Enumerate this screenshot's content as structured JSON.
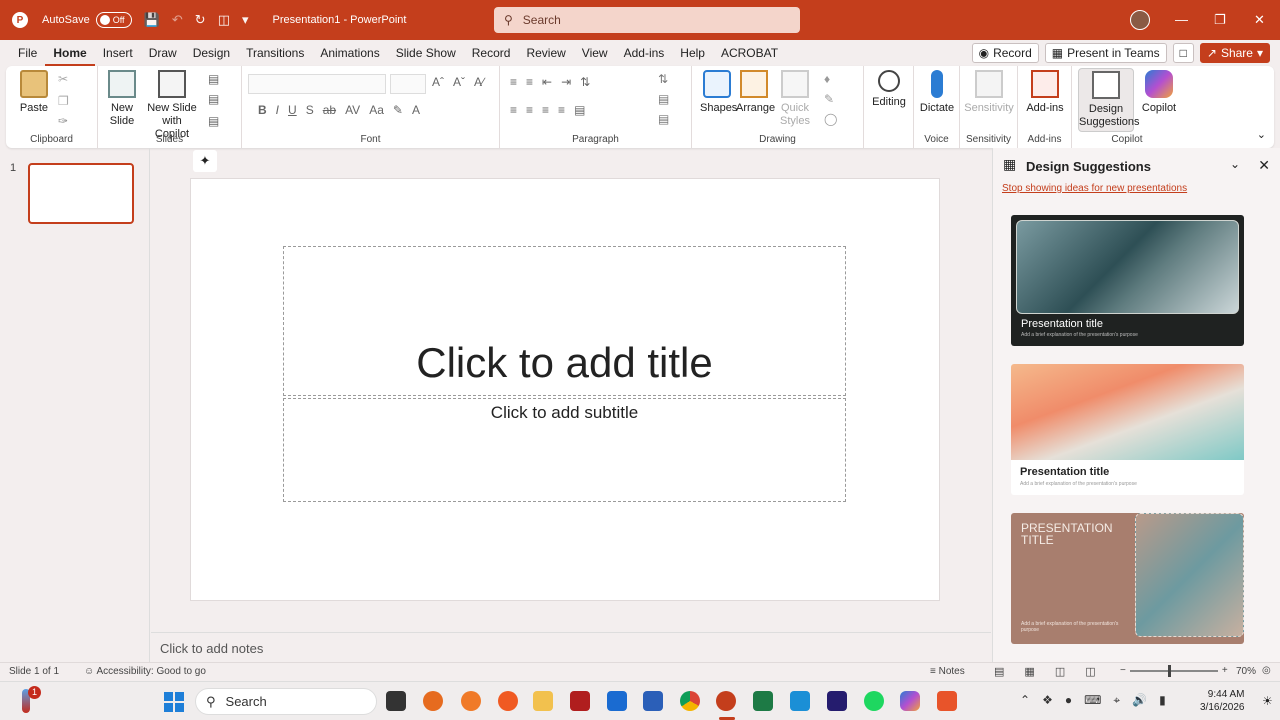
{
  "titlebar": {
    "autosave_label": "AutoSave",
    "autosave_state": "Off",
    "doc_title": "Presentation1 - PowerPoint",
    "search_placeholder": "Search"
  },
  "menu": {
    "tabs": [
      "File",
      "Home",
      "Insert",
      "Draw",
      "Design",
      "Transitions",
      "Animations",
      "Slide Show",
      "Record",
      "Review",
      "View",
      "Add-ins",
      "Help",
      "ACROBAT"
    ],
    "active_tab": "Home",
    "record_label": "Record",
    "present_label": "Present in Teams",
    "share_label": "Share"
  },
  "ribbon": {
    "clipboard": {
      "label": "Clipboard",
      "paste": "Paste"
    },
    "slides": {
      "label": "Slides",
      "new_slide": "New Slide",
      "new_slide_copilot_1": "New Slide",
      "new_slide_copilot_2": "with Copilot"
    },
    "font": {
      "label": "Font"
    },
    "paragraph": {
      "label": "Paragraph"
    },
    "drawing": {
      "label": "Drawing",
      "shapes": "Shapes",
      "arrange": "Arrange",
      "quick_styles_1": "Quick",
      "quick_styles_2": "Styles"
    },
    "editing": {
      "label": "Editing"
    },
    "voice": {
      "label": "Voice",
      "dictate": "Dictate"
    },
    "sensitivity": {
      "label": "Sensitivity",
      "button": "Sensitivity"
    },
    "addins": {
      "label": "Add-ins",
      "button": "Add-ins"
    },
    "copilot": {
      "label": "Copilot",
      "design_1": "Design",
      "design_2": "Suggestions",
      "copilot": "Copilot"
    }
  },
  "thumbnails": {
    "number": "1"
  },
  "slide": {
    "title_placeholder": "Click to add title",
    "subtitle_placeholder": "Click to add subtitle"
  },
  "notes_placeholder": "Click to add notes",
  "design_pane": {
    "title": "Design Suggestions",
    "stop_link": "Stop showing ideas for new presentations",
    "cards": [
      {
        "title": "Presentation title",
        "subtitle": "Add a brief explanation of the presentation's purpose"
      },
      {
        "title": "Presentation title",
        "subtitle": "Add a brief explanation of the presentation's purpose"
      },
      {
        "title": "PRESENTATION TITLE",
        "subtitle": "Add a brief explanation of the presentation's purpose"
      }
    ]
  },
  "statusbar": {
    "slide_info": "Slide 1 of 1",
    "accessibility": "Accessibility: Good to go",
    "notes": "Notes",
    "zoom": "70%"
  },
  "taskbar": {
    "badge": "1",
    "search": "Search",
    "time": "9:44 AM",
    "date": "3/16/2026"
  },
  "colors": {
    "accent": "#c43e1c",
    "link": "#c43e1c"
  }
}
